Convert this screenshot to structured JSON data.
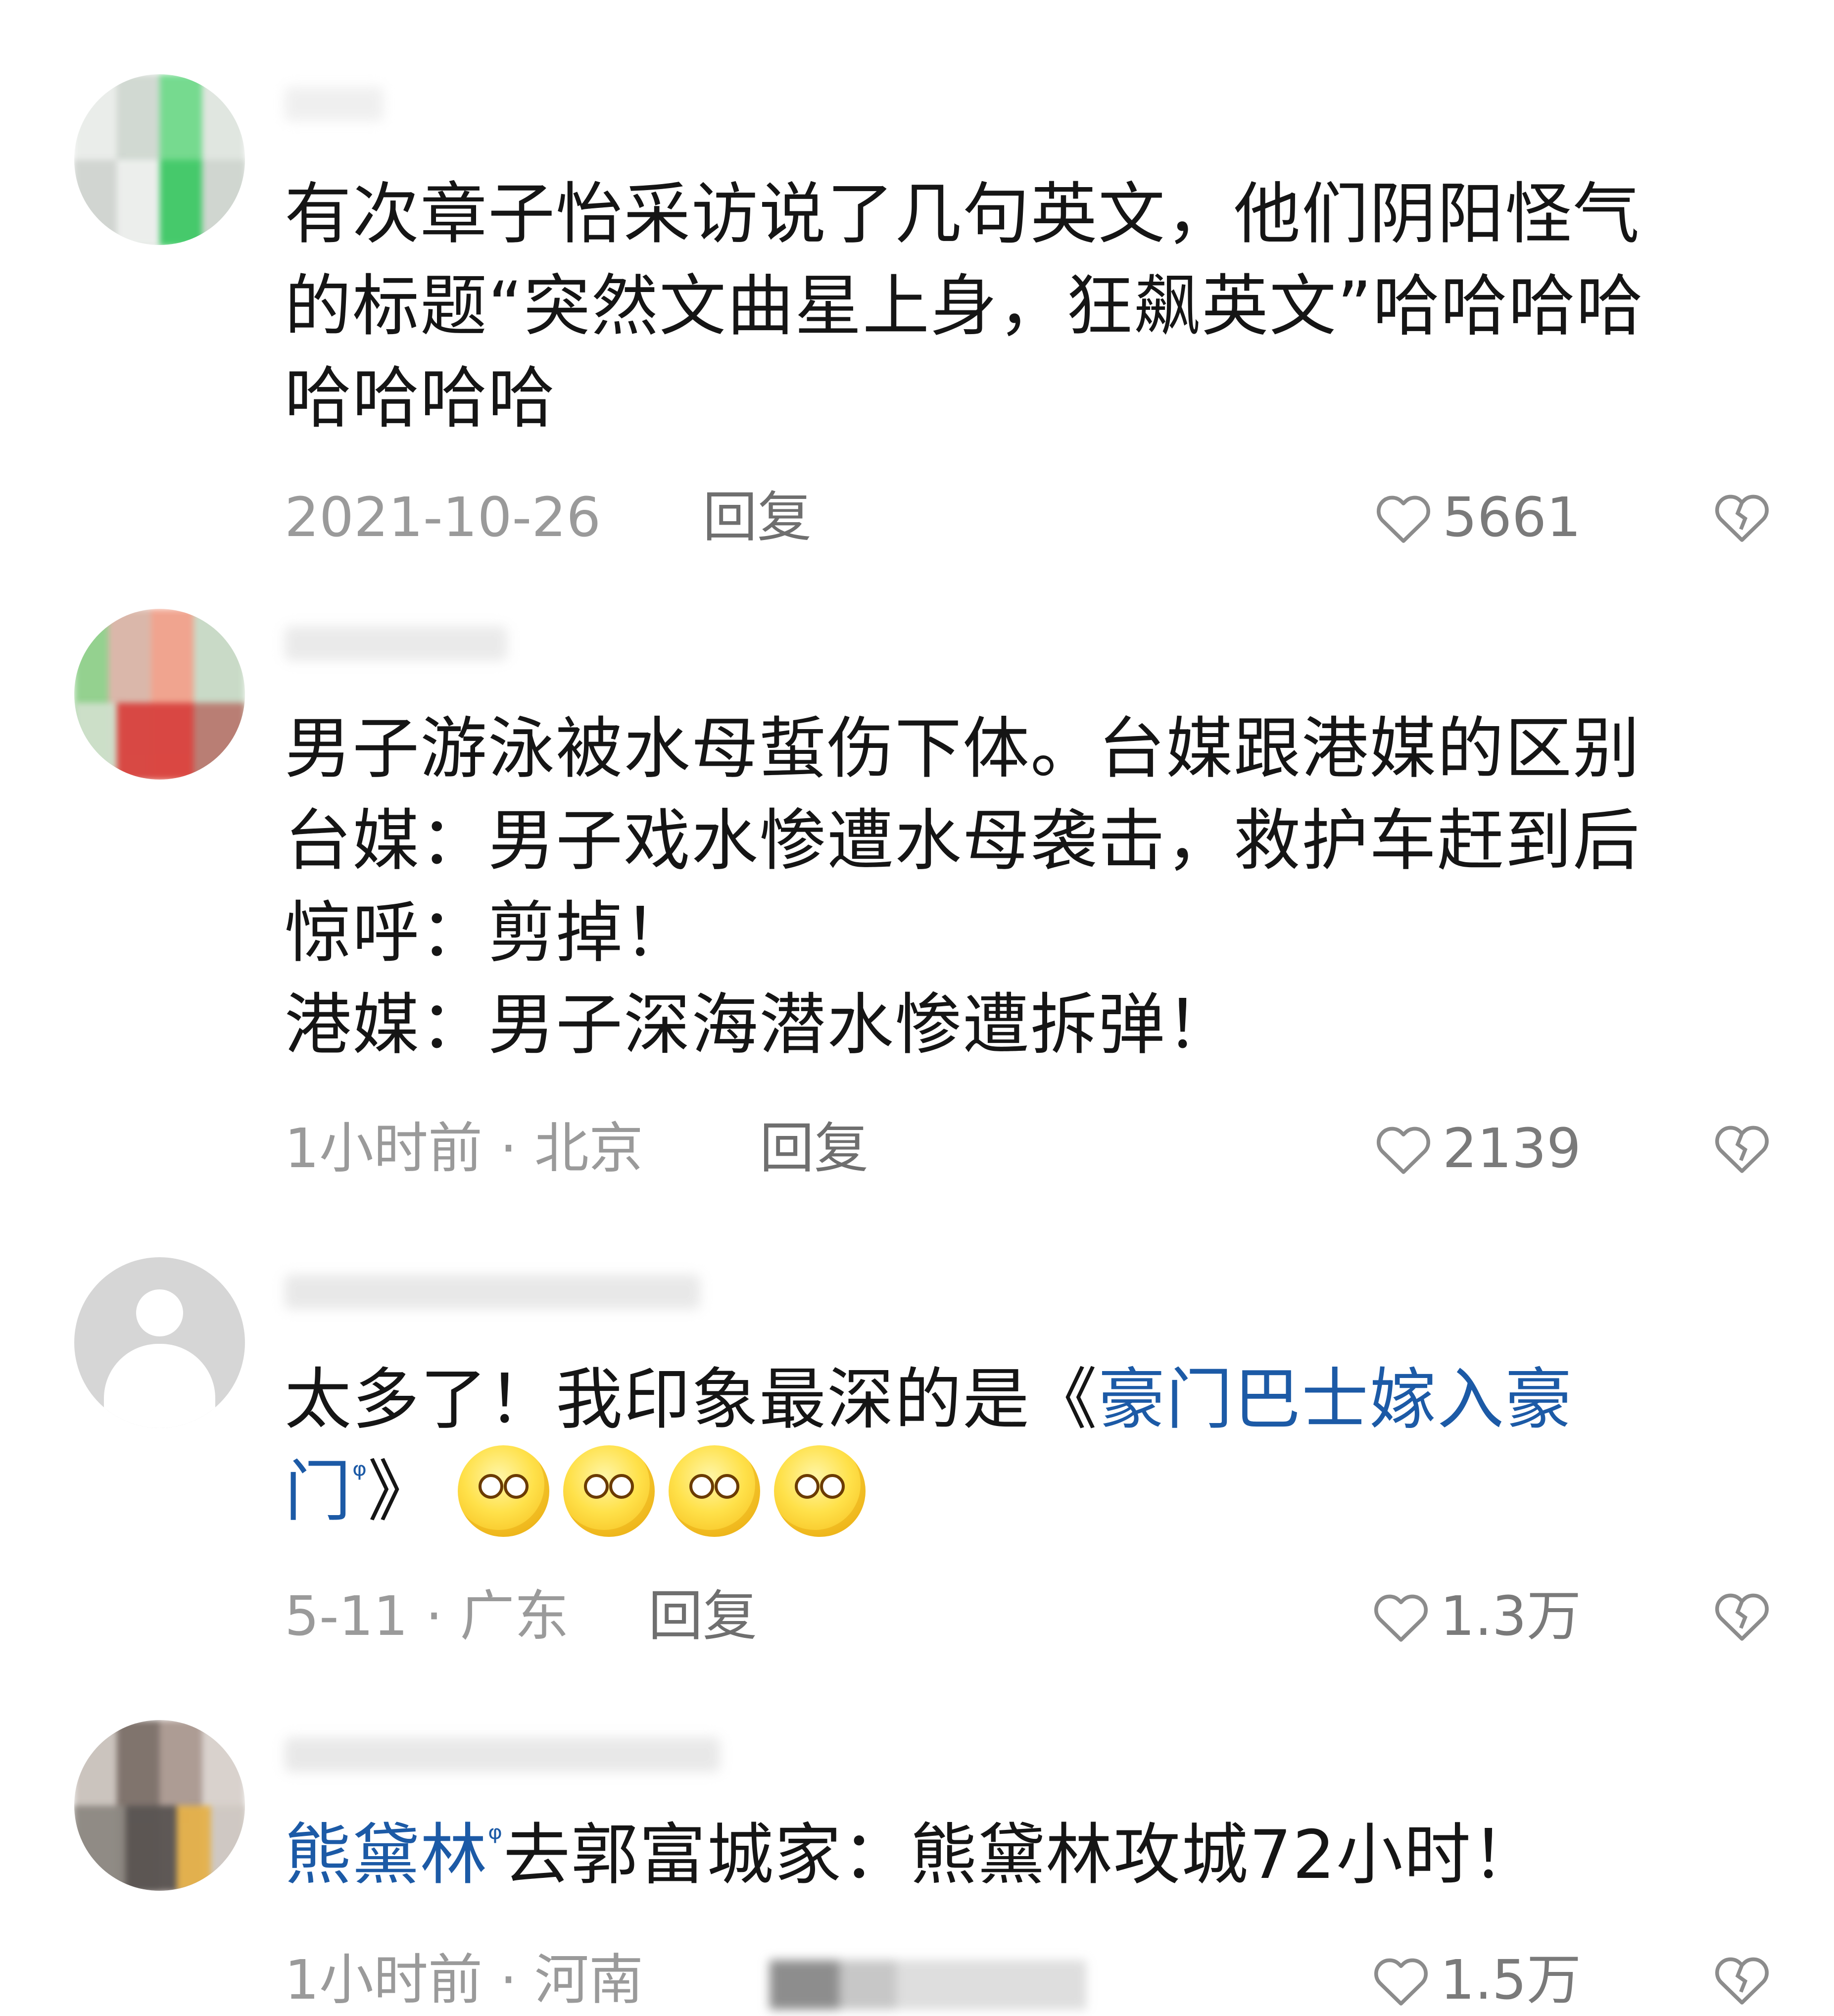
{
  "comments": [
    {
      "text": "有次章子怡采访说了几句英文，他们阴阳怪气\n的标题“突然文曲星上身，狂飙英文”哈哈哈哈\n哈哈哈哈",
      "meta": "2021-10-26",
      "reply": "回复",
      "likes": "5661"
    },
    {
      "text": "男子游泳被水母蜇伤下体。台媒跟港媒的区别\n台媒：男子戏水惨遭水母袭击，救护车赶到后\n惊呼：剪掉！\n港媒：男子深海潜水惨遭拆弹！",
      "meta": "1小时前 · 北京",
      "reply": "回复",
      "likes": "2139"
    },
    {
      "text_pre": "太多了！我印象最深的是《",
      "link": "豪门巴士嫁入豪\n门",
      "text_post": "》",
      "meta": "5-11 · 广东",
      "reply": "回复",
      "likes": "1.3万"
    },
    {
      "link": "熊黛林",
      "text_post": "去郭富城家：熊黛林攻城72小时！",
      "meta": "1小时前 · 河南",
      "likes": "1.5万"
    }
  ],
  "icons": {
    "like": "heart-outline-icon",
    "dislike": "broken-heart-icon",
    "search": "search-superscript-icon"
  },
  "colors": {
    "link": "#1c5aa6",
    "meta": "#9a9a9a",
    "text": "#151515"
  }
}
